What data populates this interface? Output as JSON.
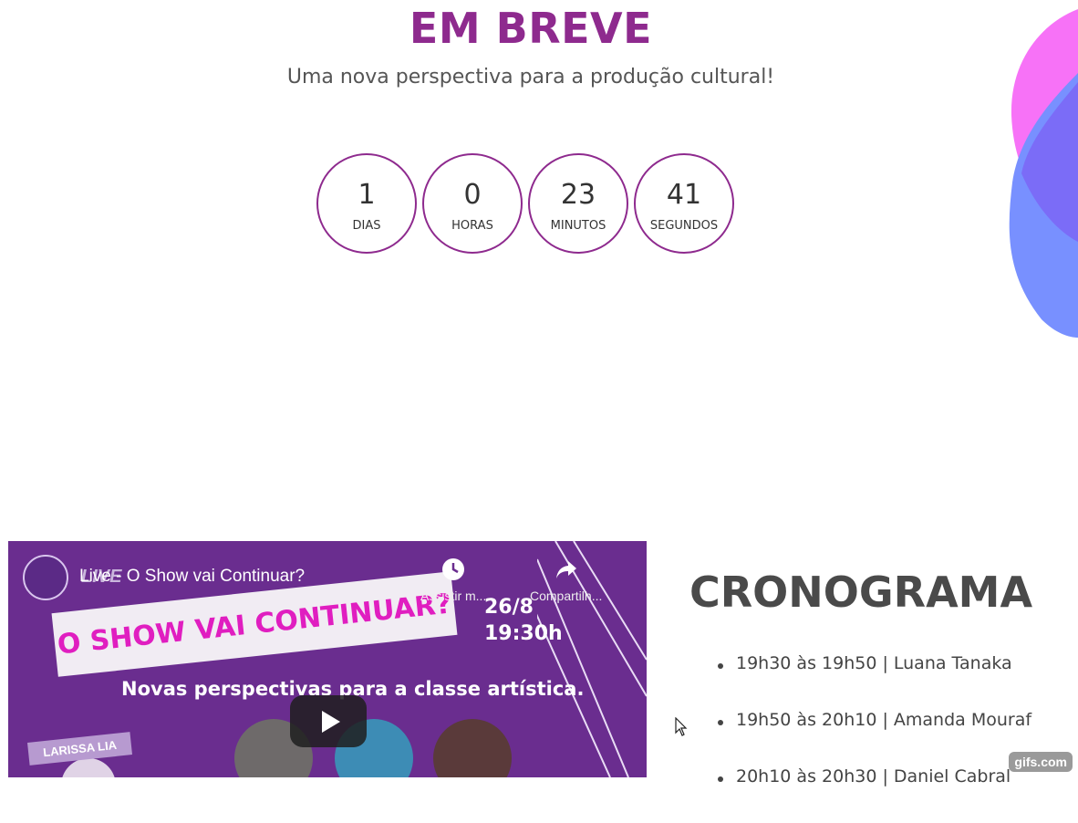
{
  "hero": {
    "title": "EM BREVE",
    "subtitle": "Uma nova perspectiva para a produção cultural!"
  },
  "countdown": [
    {
      "value": "1",
      "label": "DIAS"
    },
    {
      "value": "0",
      "label": "HORAS"
    },
    {
      "value": "23",
      "label": "MINUTOS"
    },
    {
      "value": "41",
      "label": "SEGUNDOS"
    }
  ],
  "video": {
    "title": "Live - O Show vai Continuar?",
    "watch_later": "Assistir m...",
    "share": "Compartilh...",
    "live_tag": "LIVE",
    "banner": "O SHOW VAI CONTINUAR?",
    "date": "26/8",
    "time": "19:30h",
    "tagline": "Novas perspectivas para a classe artística.",
    "host": "LARISSA LIA"
  },
  "schedule": {
    "title": "CRONOGRAMA",
    "items": [
      "19h30 às 19h50 | Luana Tanaka",
      "19h50 às 20h10 | Amanda Mouraf",
      "20h10 às 20h30 | Daniel Cabral"
    ]
  },
  "watermark": "gifs.com",
  "colors": {
    "accent": "#8e2a8e",
    "video_bg": "#6a2d8f",
    "blob_pink": "#f26cf5",
    "blob_blue": "#6e8cff"
  }
}
